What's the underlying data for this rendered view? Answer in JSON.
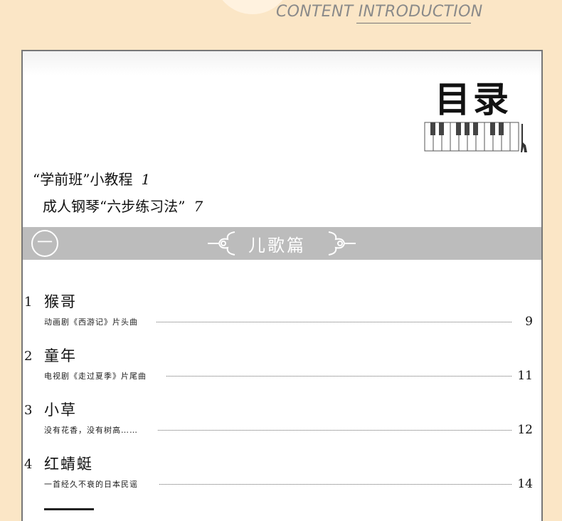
{
  "header": {
    "title": "CONTENT INTRODUCTION"
  },
  "toc": {
    "heading": "目录",
    "intro_items": [
      {
        "label": "“学前班”小教程",
        "page": "1"
      },
      {
        "label": "成人钢琴“六步练习法”",
        "page": "7"
      }
    ],
    "section": {
      "number": "一",
      "title": "儿歌篇"
    },
    "songs": [
      {
        "number": "1",
        "title": "猴哥",
        "subtitle": "动画剧《西游记》片头曲",
        "page": "9"
      },
      {
        "number": "2",
        "title": "童年",
        "subtitle": "电视剧《走过夏季》片尾曲",
        "page": "11"
      },
      {
        "number": "3",
        "title": "小草",
        "subtitle": "没有花香，没有树高……",
        "page": "12"
      },
      {
        "number": "4",
        "title": "红蜻蜓",
        "subtitle": "一首经久不衰的日本民谣",
        "page": "14"
      }
    ]
  }
}
